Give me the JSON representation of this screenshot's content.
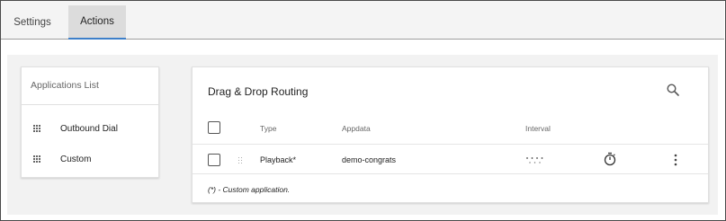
{
  "tabs": [
    {
      "label": "Settings",
      "active": false
    },
    {
      "label": "Actions",
      "active": true
    }
  ],
  "accent_color": "#3d7fc9",
  "applications_list": {
    "title": "Applications List",
    "items": [
      {
        "label": "Outbound Dial",
        "icon": "drag-grip-icon"
      },
      {
        "label": "Custom",
        "icon": "drag-grip-icon"
      }
    ]
  },
  "routing": {
    "title": "Drag & Drop Routing",
    "search_icon": "search-icon",
    "columns": {
      "type": "Type",
      "appdata": "Appdata",
      "interval": "Interval"
    },
    "rows": [
      {
        "type": "Playback*",
        "appdata": "demo-congrats",
        "interval_icon": "dotted-time-icon",
        "timer_icon": "stopwatch-icon",
        "menu_icon": "more-vertical-icon"
      }
    ],
    "footnote": "(*) - Custom application."
  }
}
